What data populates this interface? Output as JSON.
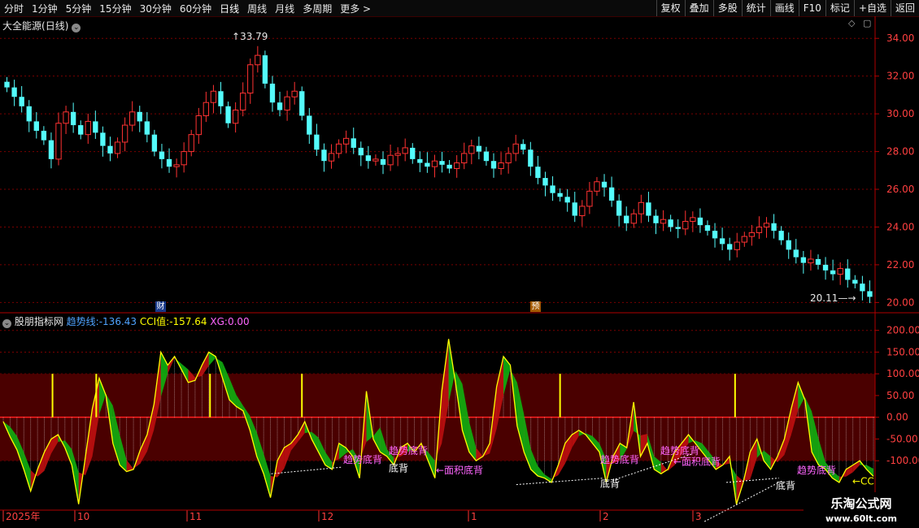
{
  "toolbar": {
    "periods": [
      "分时",
      "1分钟",
      "5分钟",
      "15分钟",
      "30分钟",
      "60分钟",
      "日线",
      "周线",
      "月线",
      "多周期",
      "更多 >"
    ],
    "active_period": "日线",
    "actions": [
      "复权",
      "叠加",
      "多股",
      "统计",
      "画线",
      "F10",
      "标记",
      "+自选",
      "返回"
    ]
  },
  "stock": {
    "name": "大全能源",
    "period_label": "(日线)",
    "high_label": "33.79",
    "low_label": "20.11"
  },
  "indicator": {
    "name": "股朋指标网",
    "trend_label": "趋势线:",
    "trend_value": "-136.43",
    "cci_label": "CCI值:",
    "cci_value": "-157.64",
    "xg_label": "XG:",
    "xg_value": "0.00"
  },
  "markers": {
    "cai": "财",
    "yu": "预"
  },
  "annotations": [
    {
      "text": "趋势底背",
      "color": "#ff66ff"
    },
    {
      "text": "趋势底背",
      "color": "#ff66ff"
    },
    {
      "text": "底背",
      "color": "#ffffff"
    },
    {
      "text": "←面积底背",
      "color": "#ff66ff"
    },
    {
      "text": "趋势底背",
      "color": "#ff66ff"
    },
    {
      "text": "底背",
      "color": "#ffffff"
    },
    {
      "text": "趋势底背",
      "color": "#ff66ff"
    },
    {
      "text": "←面积底背",
      "color": "#ff66ff"
    },
    {
      "text": "底背",
      "color": "#ffffff"
    },
    {
      "text": "趋势底背",
      "color": "#ff66ff"
    },
    {
      "text": "←CC",
      "color": "#ffff00"
    }
  ],
  "date_axis": [
    "2025年",
    "10",
    "11",
    "12",
    "1",
    "2",
    "3"
  ],
  "watermark": {
    "line1": "乐淘公式网",
    "line2": "www.60lt.com"
  },
  "colors": {
    "up": "#ff3232",
    "down": "#54fcfc",
    "grid": "#7a0000",
    "trend_line": "#ffff00"
  },
  "chart_data": [
    {
      "type": "candlestick",
      "title": "大全能源(日线)",
      "ylim": [
        19.5,
        35.0
      ],
      "yticks": [
        20.0,
        22.0,
        24.0,
        26.0,
        28.0,
        30.0,
        32.0,
        34.0
      ],
      "grid": true,
      "close_series": [
        31.4,
        30.9,
        30.4,
        29.6,
        29.1,
        28.6,
        27.6,
        29.5,
        30.1,
        29.4,
        28.9,
        29.6,
        29.0,
        28.3,
        27.9,
        28.5,
        29.4,
        30.1,
        29.6,
        28.9,
        28.0,
        27.6,
        27.2,
        27.3,
        28.0,
        28.9,
        29.9,
        30.6,
        31.2,
        30.4,
        29.5,
        30.2,
        31.1,
        32.6,
        33.1,
        31.6,
        30.6,
        30.2,
        30.9,
        31.2,
        29.9,
        28.9,
        28.1,
        27.5,
        27.9,
        28.4,
        28.7,
        28.2,
        27.8,
        27.5,
        27.6,
        27.3,
        27.8,
        27.9,
        28.2,
        27.6,
        27.4,
        27.2,
        27.5,
        27.3,
        27.1,
        27.4,
        27.9,
        28.3,
        28.0,
        27.5,
        27.1,
        27.4,
        27.9,
        28.4,
        28.1,
        27.2,
        26.6,
        26.2,
        25.8,
        25.6,
        25.3,
        24.6,
        25.1,
        25.9,
        26.4,
        26.1,
        25.4,
        24.6,
        24.2,
        24.7,
        25.3,
        24.6,
        24.2,
        24.4,
        24.0,
        23.9,
        24.3,
        24.5,
        24.1,
        23.8,
        23.4,
        23.1,
        22.8,
        23.2,
        23.5,
        23.7,
        24.0,
        24.2,
        23.8,
        23.3,
        22.8,
        22.4,
        22.1,
        22.3,
        22.0,
        21.7,
        21.5,
        21.8,
        21.2,
        21.0,
        20.6,
        20.3
      ]
    },
    {
      "type": "line",
      "title": "股朋指标网",
      "ylim": [
        -210,
        220
      ],
      "yticks": [
        200.0,
        150.0,
        100.0,
        50.0,
        0.0,
        -50.0,
        -100.0
      ],
      "grid": true,
      "series": [
        {
          "name": "趋势线",
          "values": [
            -10,
            -45,
            -75,
            -120,
            -170,
            -120,
            -80,
            -50,
            -40,
            -70,
            -110,
            -200,
            -90,
            20,
            90,
            50,
            -60,
            -110,
            -125,
            -120,
            -75,
            -40,
            30,
            150,
            120,
            140,
            110,
            80,
            85,
            120,
            150,
            140,
            90,
            40,
            25,
            15,
            -30,
            -90,
            -130,
            -185,
            -100,
            -70,
            -60,
            -40,
            -10,
            -50,
            -80,
            -110,
            -120,
            -60,
            -70,
            -90,
            -140,
            60,
            -50,
            -80,
            -90,
            -110,
            -70,
            -60,
            -80,
            -60,
            -100,
            -140,
            60,
            180,
            80,
            -30,
            -80,
            -100,
            -90,
            -60,
            70,
            140,
            120,
            -20,
            -80,
            -120,
            -135,
            -140,
            -150,
            -110,
            -60,
            -40,
            -30,
            -40,
            -60,
            -80,
            -150,
            -90,
            -60,
            -70,
            35,
            -90,
            -60,
            -120,
            -130,
            -120,
            -80,
            -60,
            -40,
            -60,
            -80,
            -100,
            -120,
            -110,
            -90,
            -200,
            -150,
            -80,
            -50,
            -100,
            -120,
            -90,
            -50,
            20,
            80,
            40,
            -80,
            -110,
            -120,
            -140,
            -150,
            -120,
            -110,
            -100,
            -120,
            -136
          ]
        }
      ]
    }
  ]
}
